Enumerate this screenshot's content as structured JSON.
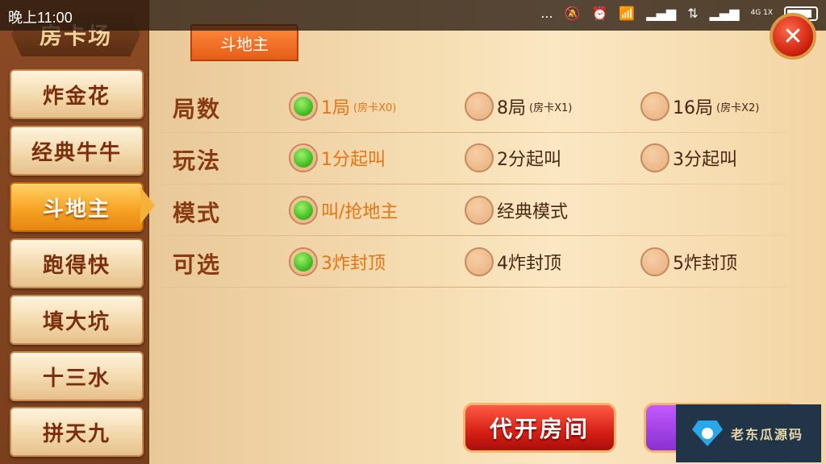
{
  "status_bar": {
    "time": "晚上11:00",
    "icons": [
      "...",
      "mute-icon",
      "alarm-icon",
      "wifi-icon",
      "signal-icon",
      "signal-icon",
      "data-icon",
      "4G 1X",
      "battery-icon"
    ]
  },
  "header": {
    "title": "房卡场"
  },
  "sidebar": {
    "items": [
      {
        "label": "炸金花",
        "active": false
      },
      {
        "label": "经典牛牛",
        "active": false
      },
      {
        "label": "斗地主",
        "active": true
      },
      {
        "label": "跑得快",
        "active": false
      },
      {
        "label": "填大坑",
        "active": false
      },
      {
        "label": "十三水",
        "active": false
      },
      {
        "label": "拼天九",
        "active": false
      }
    ]
  },
  "tab": {
    "label": "斗地主"
  },
  "options": {
    "rows": [
      {
        "label": "局数",
        "choices": [
          {
            "text": "1局",
            "sub": "(房卡X0)",
            "selected": true
          },
          {
            "text": "8局",
            "sub": "(房卡X1)",
            "selected": false
          },
          {
            "text": "16局",
            "sub": "(房卡X2)",
            "selected": false
          }
        ]
      },
      {
        "label": "玩法",
        "choices": [
          {
            "text": "1分起叫",
            "sub": "",
            "selected": true
          },
          {
            "text": "2分起叫",
            "sub": "",
            "selected": false
          },
          {
            "text": "3分起叫",
            "sub": "",
            "selected": false
          }
        ]
      },
      {
        "label": "模式",
        "choices": [
          {
            "text": "叫/抢地主",
            "sub": "",
            "selected": true
          },
          {
            "text": "经典模式",
            "sub": "",
            "selected": false
          }
        ]
      },
      {
        "label": "可选",
        "choices": [
          {
            "text": "3炸封顶",
            "sub": "",
            "selected": true
          },
          {
            "text": "4炸封顶",
            "sub": "",
            "selected": false
          },
          {
            "text": "5炸封顶",
            "sub": "",
            "selected": false
          }
        ]
      }
    ]
  },
  "buttons": {
    "open_room": "代开房间"
  },
  "watermark": {
    "text": "老东瓜源码"
  },
  "colors": {
    "accent_orange": "#e55d16",
    "selected_green": "#39b81b",
    "label_brown": "#8a3b12"
  }
}
